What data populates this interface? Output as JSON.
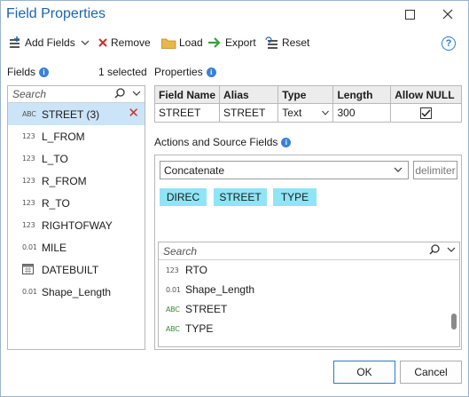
{
  "window": {
    "title": "Field Properties"
  },
  "toolbar": {
    "add_fields": "Add Fields",
    "remove": "Remove",
    "load": "Load",
    "export": "Export",
    "reset": "Reset"
  },
  "fields_panel": {
    "label": "Fields",
    "selected_count": "1 selected",
    "search_placeholder": "Search",
    "items": [
      {
        "type": "ABC",
        "name": "STREET  (3)",
        "selected": true
      },
      {
        "type": "123",
        "name": "L_FROM"
      },
      {
        "type": "123",
        "name": "L_TO"
      },
      {
        "type": "123",
        "name": "R_FROM"
      },
      {
        "type": "123",
        "name": "R_TO"
      },
      {
        "type": "123",
        "name": "RIGHTOFWAY"
      },
      {
        "type": "0.01",
        "name": "MILE"
      },
      {
        "type": "date",
        "name": "DATEBUILT"
      },
      {
        "type": "0.01",
        "name": "Shape_Length"
      }
    ]
  },
  "properties": {
    "label": "Properties",
    "headers": [
      "Field Name",
      "Alias",
      "Type",
      "Length",
      "Allow NULL"
    ],
    "row": {
      "field_name": "STREET",
      "alias": "STREET",
      "type": "Text",
      "length": "300",
      "allow_null": true
    }
  },
  "actions": {
    "label": "Actions and Source Fields",
    "action": "Concatenate",
    "delimiter_placeholder": "delimiter",
    "chips": [
      "DIREC",
      "STREET",
      "TYPE"
    ],
    "search_placeholder": "Search",
    "source_items": [
      {
        "type": "123",
        "name": "RTO"
      },
      {
        "type": "0.01",
        "name": "Shape_Length"
      },
      {
        "type": "ABC",
        "name": "STREET"
      },
      {
        "type": "ABC",
        "name": "TYPE"
      }
    ]
  },
  "buttons": {
    "ok": "OK",
    "cancel": "Cancel"
  },
  "colors": {
    "title": "#1d64ad",
    "chip": "#8ee5f6",
    "selection": "#cce4f7",
    "remove_red": "#c9302c"
  }
}
